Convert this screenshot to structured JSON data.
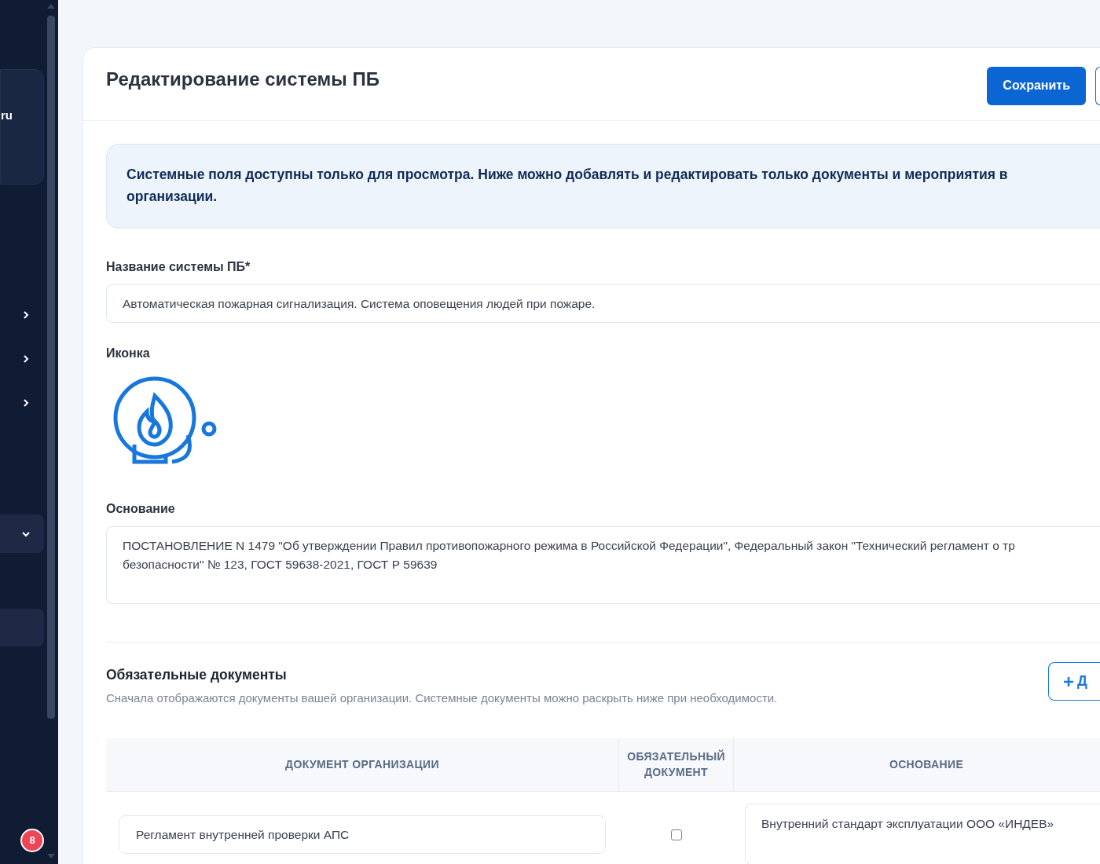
{
  "sidebar": {
    "brand_fragment": "ru",
    "items": [
      {
        "kind": "collapsed"
      },
      {
        "kind": "collapsed"
      },
      {
        "kind": "collapsed"
      },
      {
        "kind": "expanded"
      },
      {
        "kind": "selected"
      }
    ],
    "badge": "8"
  },
  "page": {
    "title": "Редактирование системы ПБ",
    "buttons": [
      {
        "label": "Сохранить",
        "kind": "primary"
      },
      {
        "kind": "outline"
      }
    ]
  },
  "notice": {
    "lines": [
      "Системные поля доступны только для просмотра. Ниже можно добавлять и редактировать только документы и мероприятия в",
      "организации."
    ]
  },
  "fields": [
    {
      "kind": "input",
      "label": "Название системы ПБ*",
      "value": "Автоматическая пожарная сигнализация. Система оповещения людей при пожаре."
    },
    {
      "kind": "icon",
      "label": "Иконка"
    },
    {
      "kind": "textarea",
      "label": "Основание",
      "lines": [
        "ПОСТАНОВЛЕНИЕ N 1479 \"Об утверждении Правил противопожарного режима в Российской Федерации\", Федеральный закон \"Технический регламент о тр",
        "безопасности\" № 123, ГОСТ 59638-2021, ГОСТ Р 59639"
      ]
    }
  ],
  "documents": {
    "title": "Обязательные документы",
    "subtitle": "Сначала отображаются документы вашей организации. Системные документы можно раскрыть ниже при необходимости.",
    "add_button": "Д",
    "table": {
      "columns": [
        "ДОКУМЕНТ ОРГАНИЗАЦИИ",
        "ОБЯЗАТЕЛЬНЫЙ ДОКУМЕНТ",
        "ОСНОВАНИЕ"
      ],
      "rows": [
        {
          "document": "Регламент внутренней проверки АПС",
          "required": false,
          "basis": "Внутренний стандарт эксплуатации ООО «ИНДЕВ»"
        }
      ]
    }
  }
}
